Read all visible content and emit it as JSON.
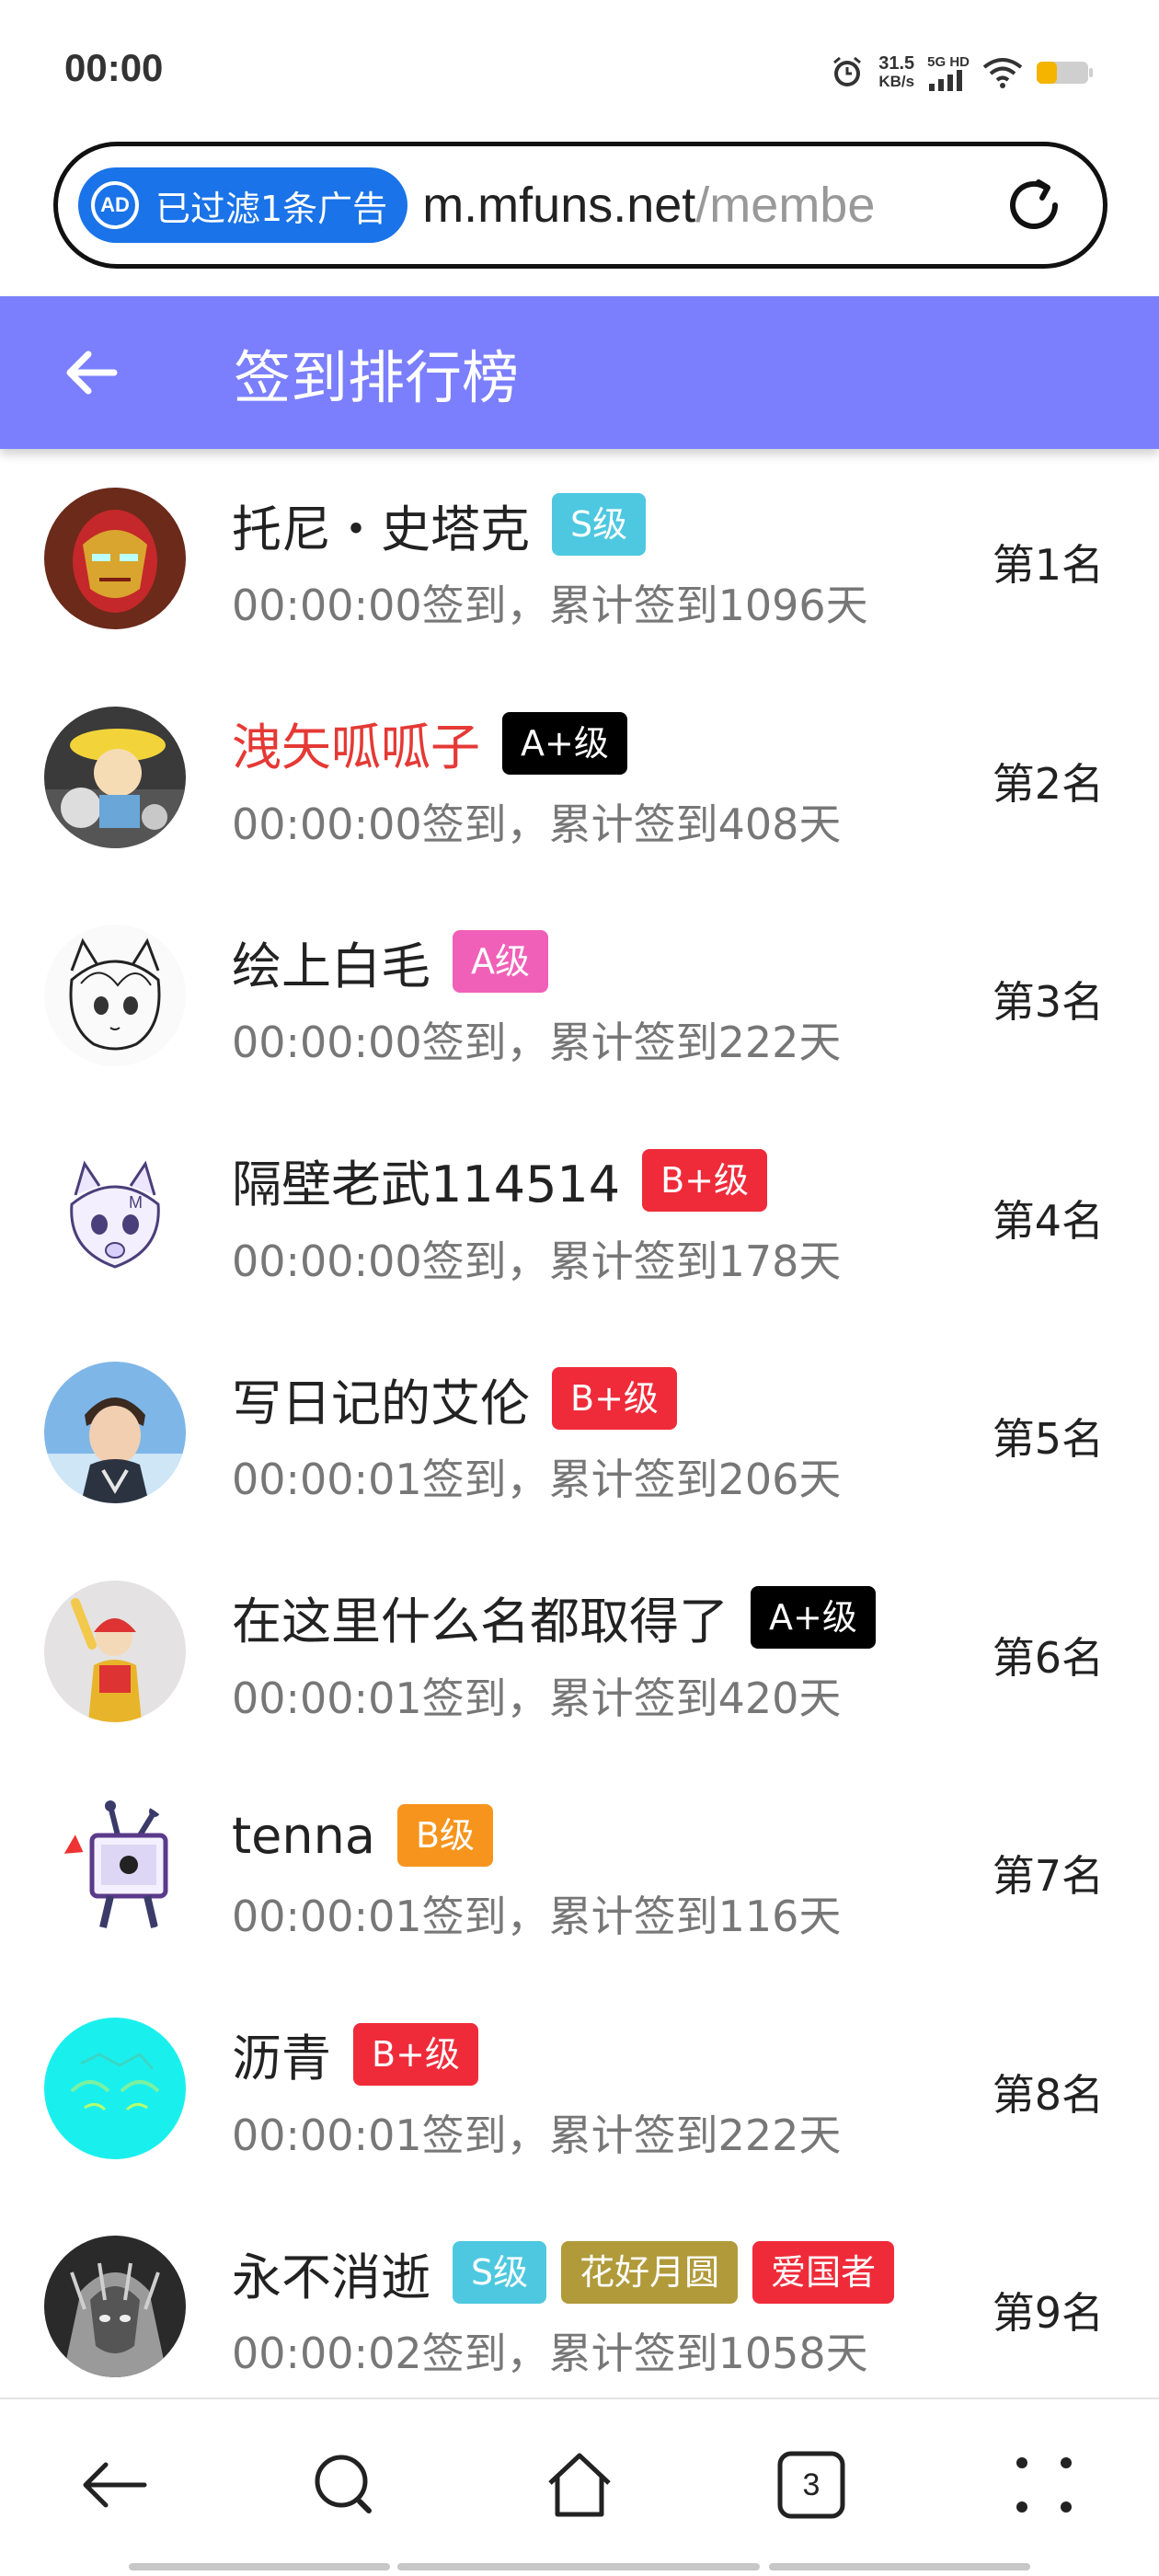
{
  "status_bar": {
    "time": "00:00",
    "net_speed_value": "31.5",
    "net_speed_unit": "KB/s",
    "signal_label": "5G HD",
    "icons": [
      "alarm-icon",
      "signal-icon",
      "wifi-icon",
      "battery-icon"
    ],
    "battery_color": "#f4b400"
  },
  "browser": {
    "ad_filter_label": "已过滤1条广告",
    "ad_badge_text": "AD",
    "url_host": "m.mfuns.net",
    "url_path": "/membe",
    "accent": "#1a73e8"
  },
  "header": {
    "title": "签到排行榜",
    "background": "#7b7ffd"
  },
  "ranking": [
    {
      "name": "托尼・史塔克",
      "name_color": "normal",
      "badges": [
        {
          "label": "S级",
          "color": "#4dc8e0"
        }
      ],
      "sub": "00:00:00签到，累计签到1096天",
      "rank": "第1名"
    },
    {
      "name": "洩矢呱呱子",
      "name_color": "red",
      "badges": [
        {
          "label": "A+级",
          "color": "#000000"
        }
      ],
      "sub": "00:00:00签到，累计签到408天",
      "rank": "第2名"
    },
    {
      "name": "绘上白毛",
      "name_color": "normal",
      "badges": [
        {
          "label": "A级",
          "color": "#f060b8"
        }
      ],
      "sub": "00:00:00签到，累计签到222天",
      "rank": "第3名"
    },
    {
      "name": "隔壁老武114514",
      "name_color": "normal",
      "badges": [
        {
          "label": "B+级",
          "color": "#ef2b3a"
        }
      ],
      "sub": "00:00:00签到，累计签到178天",
      "rank": "第4名"
    },
    {
      "name": "写日记的艾伦",
      "name_color": "normal",
      "badges": [
        {
          "label": "B+级",
          "color": "#ef2b3a"
        }
      ],
      "sub": "00:00:01签到，累计签到206天",
      "rank": "第5名"
    },
    {
      "name": "在这里什么名都取得了",
      "name_color": "normal",
      "badges": [
        {
          "label": "A+级",
          "color": "#000000"
        }
      ],
      "sub": "00:00:01签到，累计签到420天",
      "rank": "第6名"
    },
    {
      "name": "tenna",
      "name_color": "normal",
      "badges": [
        {
          "label": "B级",
          "color": "#f7941d"
        }
      ],
      "sub": "00:00:01签到，累计签到116天",
      "rank": "第7名"
    },
    {
      "name": "沥青",
      "name_color": "normal",
      "badges": [
        {
          "label": "B+级",
          "color": "#ef2b3a"
        }
      ],
      "sub": "00:00:01签到，累计签到222天",
      "rank": "第8名"
    },
    {
      "name": "永不消逝",
      "name_color": "normal",
      "badges": [
        {
          "label": "S级",
          "color": "#4dc8e0"
        },
        {
          "label": "花好月圆",
          "color": "#b09a3a"
        },
        {
          "label": "爱国者",
          "color": "#ef2b3a"
        }
      ],
      "sub": "00:00:02签到，累计签到1058天",
      "rank": "第9名"
    }
  ],
  "bottom_nav": {
    "items": [
      "back-icon",
      "search-icon",
      "home-icon",
      "tabs-icon",
      "menu-icon"
    ],
    "tab_count": "3"
  }
}
